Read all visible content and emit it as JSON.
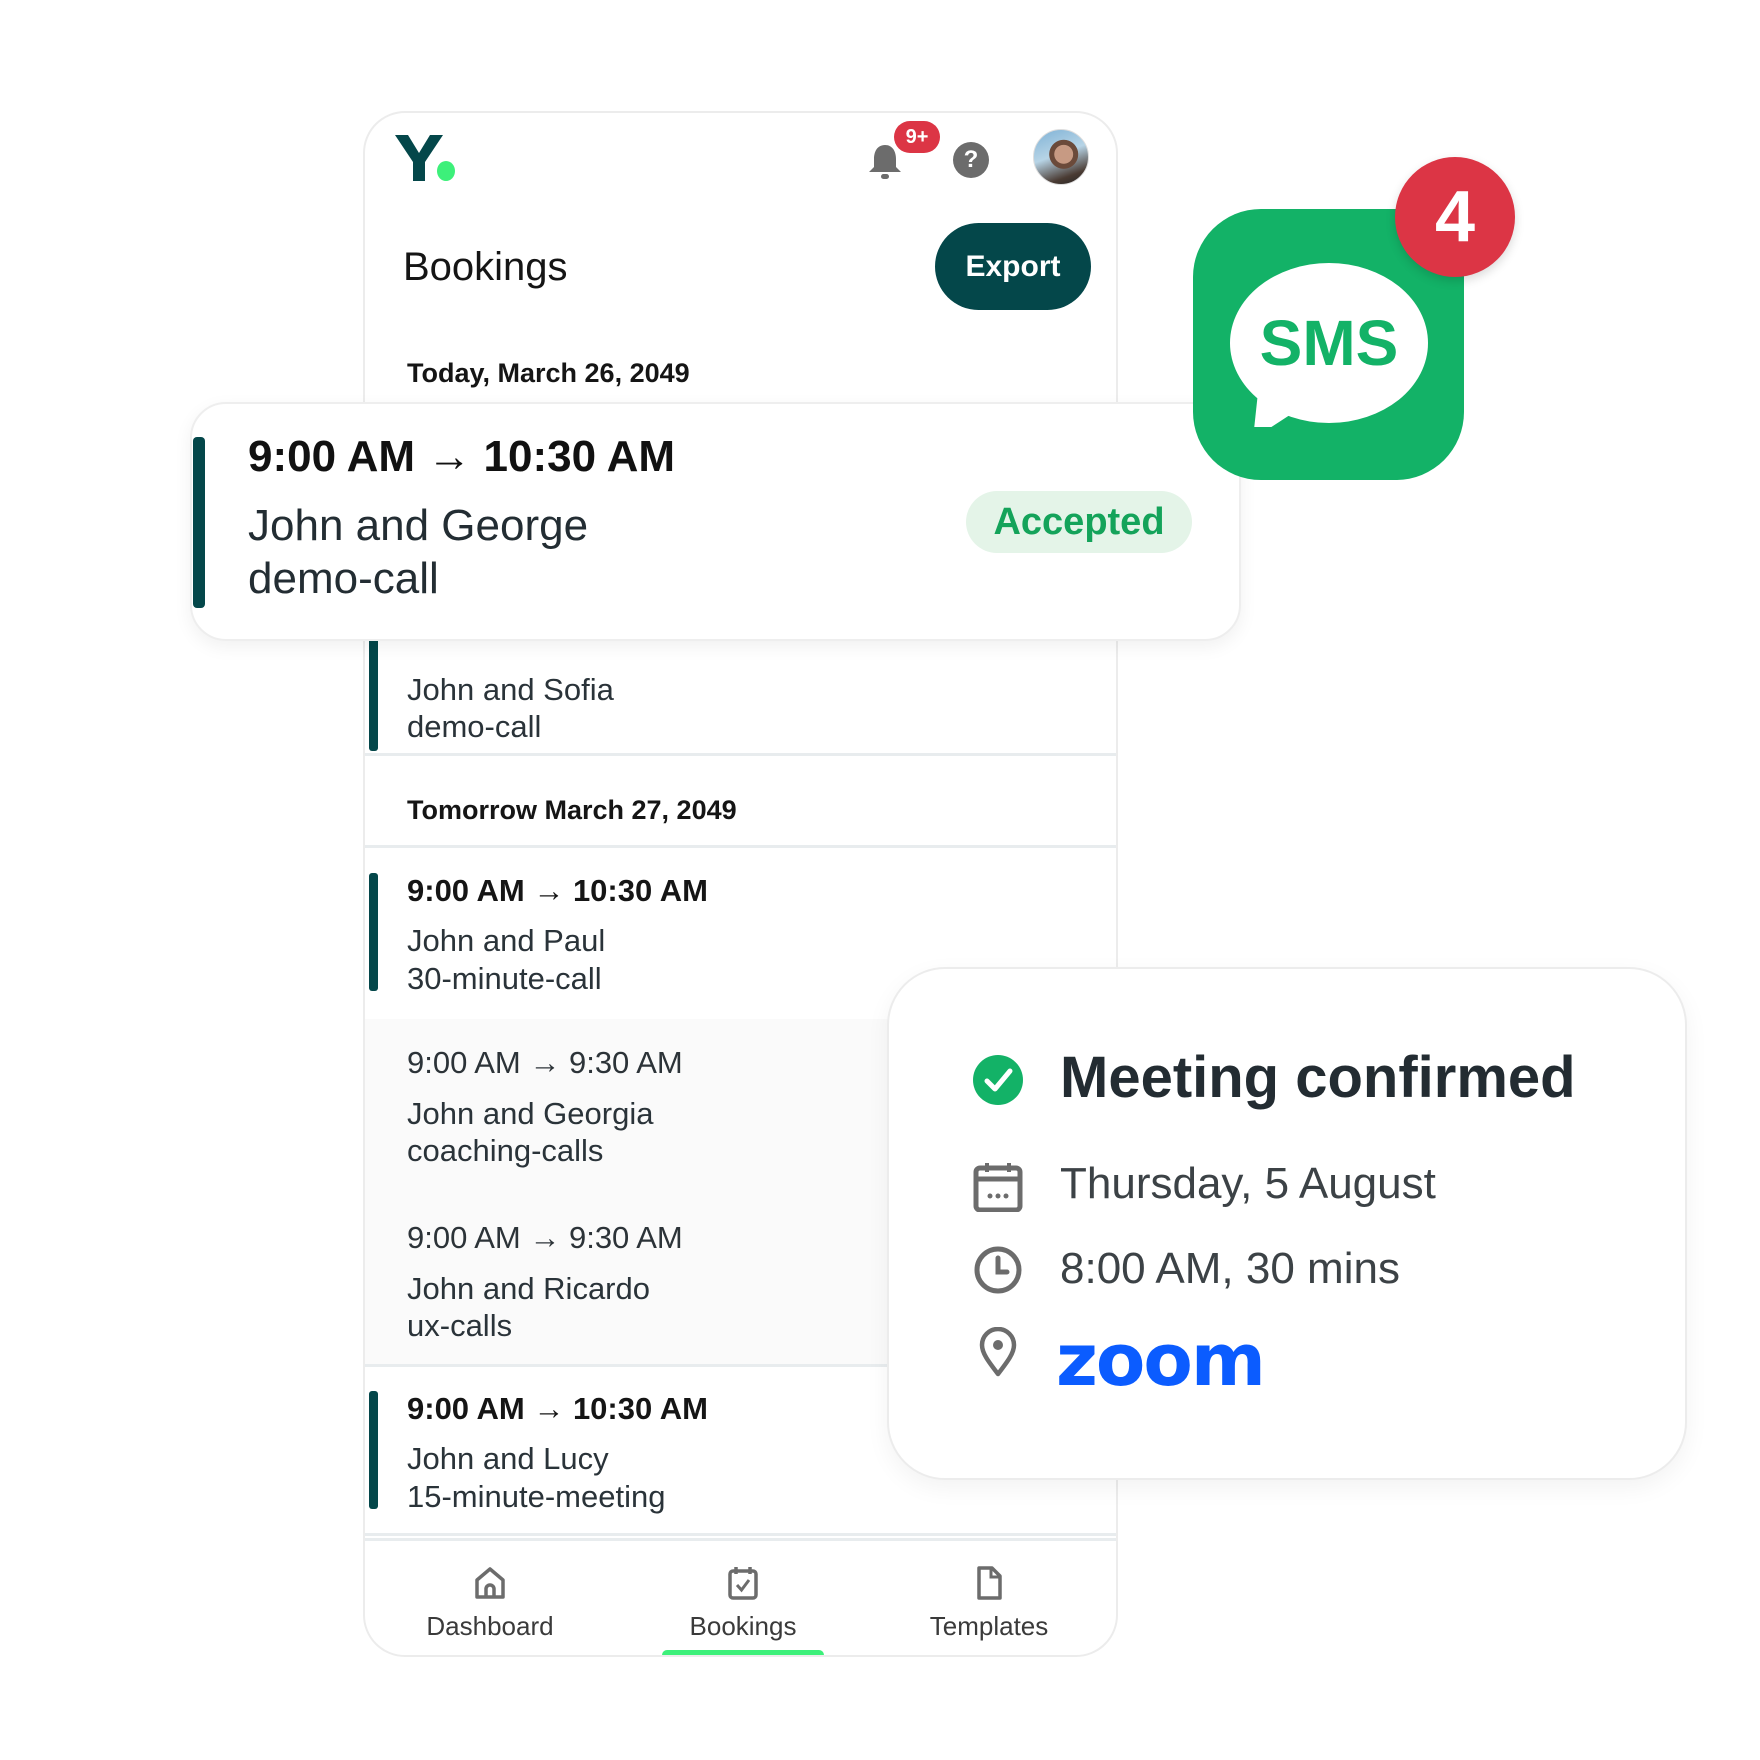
{
  "app": {
    "logo_letter": "Y",
    "notifications_badge": "9+",
    "help_glyph": "?",
    "page_title": "Bookings",
    "export_label": "Export"
  },
  "colors": {
    "primary": "#04474a",
    "accent_green": "#3df07a",
    "badge_red": "#dc3545",
    "sms_green": "#13b267",
    "accepted_green": "#14a35a",
    "zoom_blue": "#0b5cff"
  },
  "sections": [
    {
      "date_label": "Today, March 26, 2049",
      "bookings": [
        {
          "time": "9:00 AM → 10:30 AM",
          "name": "John and George",
          "type": "demo-call",
          "status": "Accepted",
          "highlighted": true
        },
        {
          "name": "John and Sofia",
          "type": "demo-call"
        }
      ]
    },
    {
      "date_label": "Tomorrow March 27, 2049",
      "bookings": [
        {
          "time": "9:00 AM → 10:30 AM",
          "name": "John and Paul",
          "type": "30-minute-call"
        },
        {
          "time": "9:00 AM → 9:30 AM",
          "name": "John and Georgia",
          "type": "coaching-calls"
        },
        {
          "time": "9:00 AM → 9:30 AM",
          "name": "John and Ricardo",
          "type": "ux-calls"
        },
        {
          "time": "9:00 AM → 10:30 AM",
          "name": "John and Lucy",
          "type": "15-minute-meeting"
        }
      ]
    }
  ],
  "nav": {
    "items": [
      {
        "label": "Dashboard",
        "icon": "home-icon"
      },
      {
        "label": "Bookings",
        "icon": "calendar-check-icon",
        "active": true
      },
      {
        "label": "Templates",
        "icon": "document-icon"
      }
    ]
  },
  "sms": {
    "label": "SMS",
    "badge_count": "4"
  },
  "meeting_card": {
    "title": "Meeting confirmed",
    "date": "Thursday, 5 August",
    "time": "8:00 AM, 30 mins",
    "location_brand": "zoom"
  }
}
